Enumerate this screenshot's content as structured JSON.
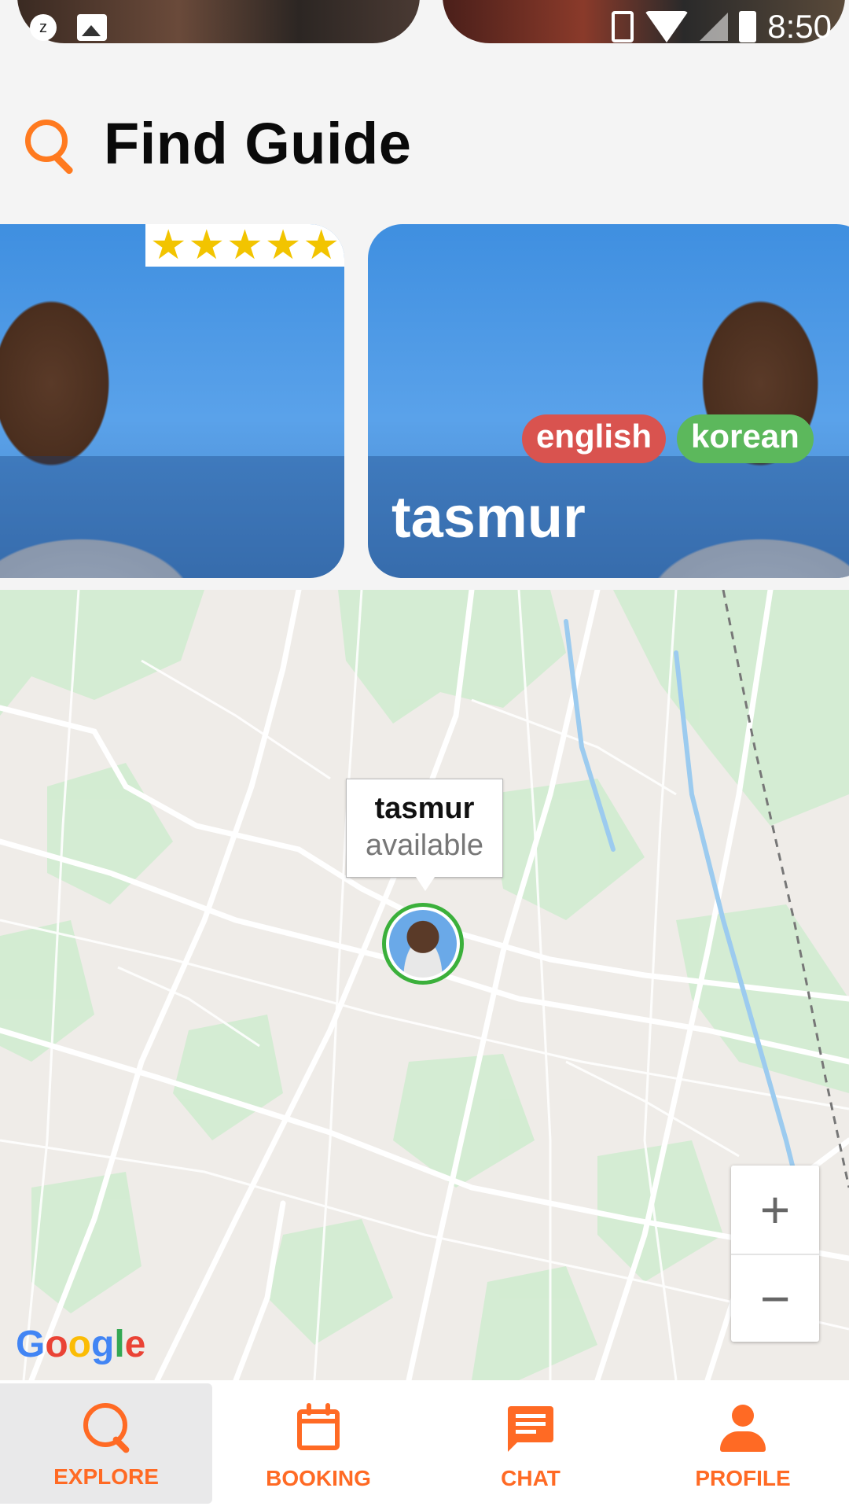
{
  "status_bar": {
    "time": "8:50",
    "left_icons": [
      "z-icon",
      "image-icon"
    ],
    "right_icons": [
      "vibrate-icon",
      "wifi-icon",
      "cell-signal-icon",
      "battery-icon"
    ]
  },
  "header": {
    "icon": "search-icon",
    "title": "Find Guide"
  },
  "carousel": {
    "cards": [
      {
        "rating": 5,
        "stars": "★★★★★"
      },
      {
        "name": "tasmur",
        "languages": [
          "english",
          "korean"
        ],
        "language_colors": [
          "#d9534f",
          "#5cb85c"
        ]
      }
    ]
  },
  "map": {
    "marker": {
      "name": "tasmur",
      "status": "available",
      "border_color": "#3bb03b"
    },
    "zoom_in_label": "+",
    "zoom_out_label": "−",
    "attribution": "Google"
  },
  "nav": {
    "accent": "#ff6a24",
    "items": [
      {
        "label": "EXPLORE",
        "icon": "search-icon",
        "active": true
      },
      {
        "label": "BOOKING",
        "icon": "calendar-icon",
        "active": false
      },
      {
        "label": "CHAT",
        "icon": "chat-icon",
        "active": false
      },
      {
        "label": "PROFILE",
        "icon": "person-icon",
        "active": false
      }
    ]
  }
}
